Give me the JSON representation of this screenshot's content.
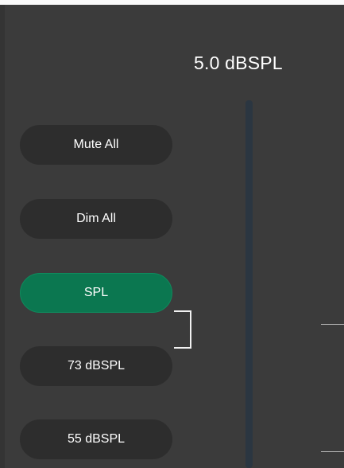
{
  "monitor": {
    "level_readout": "5.0 dBSPL",
    "buttons": {
      "mute_all": "Mute All",
      "dim_all": "Dim All",
      "spl": "SPL"
    },
    "presets": [
      {
        "label": "73 dBSPL"
      },
      {
        "label": "55 dBSPL"
      }
    ]
  },
  "colors": {
    "background": "#3b3b3b",
    "button_bg": "#2d2d2d",
    "active_button": "#0b7750",
    "fader_track": "#2b3641",
    "text": "#ffffff"
  }
}
